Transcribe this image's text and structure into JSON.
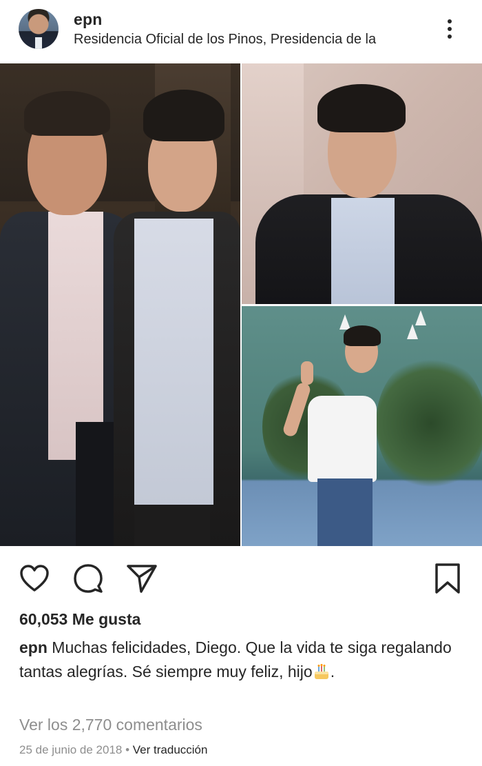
{
  "post": {
    "username": "epn",
    "location": "Residencia Oficial de los Pinos, Presidencia de la",
    "likes": "60,053 Me gusta",
    "caption_user": "epn",
    "caption_text": "Muchas felicidades, Diego. Que la vida te siga regalando tantas alegrías. Sé siempre muy feliz, hijo",
    "caption_end": ".",
    "view_comments": "Ver los 2,770 comentarios",
    "date": "25 de junio de 2018",
    "separator": "•",
    "translate": "Ver traducción"
  },
  "icons": {
    "more": "more-options-icon",
    "like": "heart-icon",
    "comment": "comment-bubble-icon",
    "share": "paper-plane-icon",
    "save": "bookmark-icon",
    "emoji": "birthday-cake-emoji"
  },
  "colors": {
    "text": "#262626",
    "secondary": "#8e8e8e",
    "background": "#ffffff"
  }
}
